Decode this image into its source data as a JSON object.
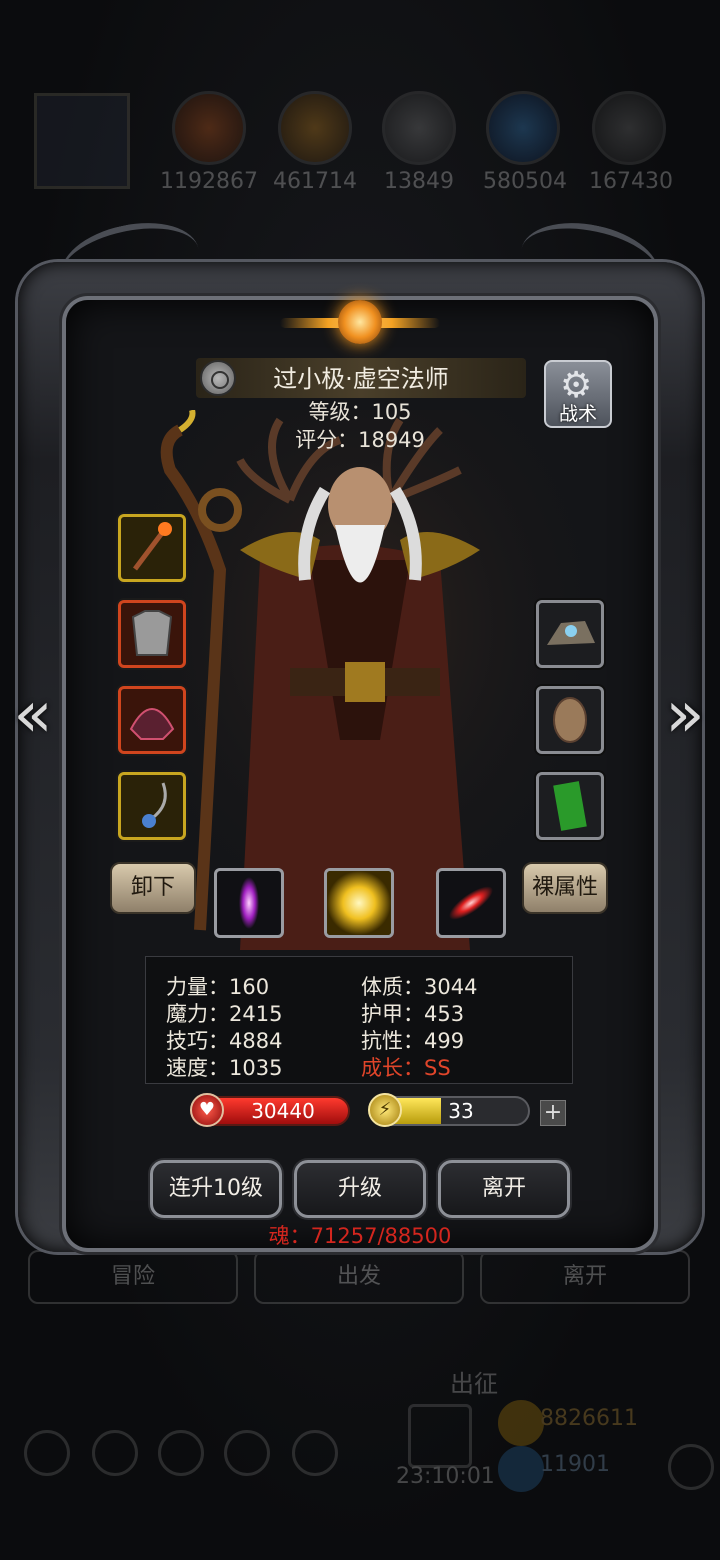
{
  "background": {
    "resources": [
      "1192867",
      "461714",
      "13849",
      "580504",
      "167430"
    ],
    "tabs": [
      "冒险",
      "出发",
      "离开"
    ],
    "expedition_label": "出征",
    "gold": "8826611",
    "gems": "11901",
    "timer": "23:10:01"
  },
  "hero": {
    "name": "过小极·虚空法师",
    "level_label": "等级：105",
    "score_label": "评分：18949"
  },
  "tactics_button": "战术",
  "equipment": {
    "left_slots": [
      "staff-icon",
      "chest-armor-icon",
      "helmet-icon",
      "amulet-icon"
    ],
    "right_slots": [
      "ore-stone-icon",
      "shell-icon",
      "green-scroll-icon"
    ]
  },
  "buttons": {
    "unequip": "卸下",
    "base_attributes": "裸属性",
    "level_up_10": "连升10级",
    "level_up": "升级",
    "leave": "离开"
  },
  "skills": [
    "purple-crystal-skill-icon",
    "golden-burst-skill-icon",
    "red-slash-skill-icon"
  ],
  "stats": {
    "strength": "力量：160",
    "magic": "魔力：2415",
    "skill": "技巧：4884",
    "speed": "速度：1035",
    "constitution": "体质：3044",
    "armor": "护甲：453",
    "resistance": "抗性：499",
    "growth": "成长：SS"
  },
  "hp": {
    "value": "30440",
    "fill": 1.0
  },
  "energy": {
    "value": "33",
    "fill": 0.44
  },
  "soul": "魂：71257/88500",
  "colors": {
    "accent_gold": "#c8a620",
    "hp_red": "#d81e1e",
    "growth_red": "#e0452a",
    "soul_red": "#d3261e"
  }
}
